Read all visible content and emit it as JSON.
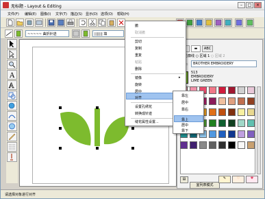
{
  "window": {
    "title": "无标题 - Layout & Editing"
  },
  "menubar": {
    "items": [
      "文件(F)",
      "编辑(E)",
      "图像(I)",
      "文字(T)",
      "描边(S)",
      "显示(D)",
      "选项(O)",
      "帮助(H)"
    ]
  },
  "toolbar2": {
    "line_style": "曲折针迹",
    "fill_pattern": "填"
  },
  "context_menu": {
    "items": [
      {
        "label": "撤",
        "disabled": false
      },
      {
        "label": "取消撤",
        "disabled": true
      },
      {
        "label": "剪切",
        "disabled": false
      },
      {
        "label": "复制",
        "disabled": false
      },
      {
        "label": "重复",
        "disabled": false
      },
      {
        "label": "粘贴",
        "disabled": true
      },
      {
        "label": "删除",
        "disabled": false
      },
      {
        "label": "镜像",
        "disabled": false
      },
      {
        "label": "旋转",
        "disabled": false
      },
      {
        "label": "居中",
        "disabled": false
      },
      {
        "label": "对齐",
        "disabled": false
      },
      {
        "label": "设置孔绣花",
        "disabled": false
      },
      {
        "label": "转换成针迹",
        "disabled": false
      },
      {
        "label": "缝花属性设置...",
        "disabled": false
      }
    ],
    "highlighted": "对齐"
  },
  "submenu": {
    "items": [
      "靠左",
      "居中",
      "靠右",
      "靠上",
      "居中",
      "靠下"
    ],
    "highlighted": "靠上"
  },
  "panel": {
    "tab_abc": "ABC",
    "radio_outline": "轮廓线",
    "radio_area": "区域 1",
    "radio_area2": "区域 2",
    "thread_label": "线条:",
    "thread_brand": "BROTHER EMBROIDERY",
    "thread_code": "513",
    "thread_brand2": "EMBROIDERY",
    "thread_name": "LIME GREEN",
    "pattern_button": "室列表模式"
  },
  "colors": {
    "leaf": "#7dbb2e",
    "swatches": [
      "#f5a0b5",
      "#f090a8",
      "#e84a6a",
      "#f07888",
      "#d01c3c",
      "#a01830",
      "#d0d0d0",
      "#e8c8d8",
      "#f0a0c0",
      "#d83070",
      "#b0206a",
      "#8a1c5a",
      "#f0c0a0",
      "#e0a080",
      "#c07050",
      "#904020",
      "#f0e060",
      "#e8c020",
      "#f0a020",
      "#e07018",
      "#c05010",
      "#803010",
      "#f8f0a0",
      "#e8d890",
      "#c0e070",
      "#80c040",
      "#50a030",
      "#208020",
      "#106030",
      "#104020",
      "#a0d8c8",
      "#60c0b0",
      "#209090",
      "#106878",
      "#90c8f0",
      "#5098e0",
      "#2060c0",
      "#103890",
      "#c0a0e0",
      "#8060c0",
      "#603090",
      "#402070",
      "#8a8a8a",
      "#606060",
      "#303030",
      "#000000",
      "#f8f8f8",
      "#c8a070"
    ]
  },
  "status": {
    "text": "请选择对象进行对齐"
  }
}
